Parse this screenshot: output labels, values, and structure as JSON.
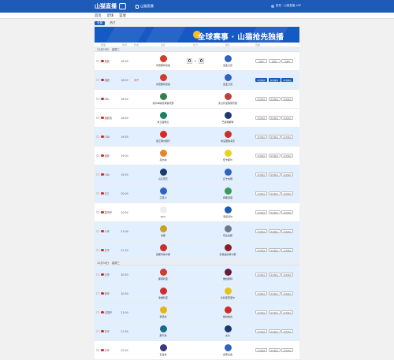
{
  "header": {
    "logo_text": "山猫直播",
    "app_label": "山猫直播",
    "login_text": "登录 · 山猫直播 APP"
  },
  "nav": [
    "首页",
    "足球",
    "篮球"
  ],
  "tabs": [
    "全部",
    "热门"
  ],
  "banner": {
    "title": "全球赛事 · 山猫抢先独播"
  },
  "columns": [
    "赛事",
    "时间",
    "状态",
    "主队",
    "比分",
    "客队",
    "直播"
  ],
  "days": [
    {
      "date": "12月29日",
      "weekday": "星期二",
      "matches": [
        {
          "league": "英超",
          "time": "18:00",
          "status": "",
          "home": "布雷斯特竞技",
          "away": "圣亚力克",
          "score": [
            "0",
            "0"
          ],
          "live": false,
          "home_color": "#d13b2c",
          "away_color": "#2f63c2",
          "links": [
            "直播1",
            "直播2",
            "直播3"
          ],
          "links_on": [
            false,
            false,
            false
          ]
        },
        {
          "league": "英超",
          "time": "18:00",
          "status": "未开",
          "home": "布雷斯特竞技",
          "away": "圣亚力克",
          "score": null,
          "live": true,
          "home_color": "#d13b2c",
          "away_color": "#2f63c2",
          "links": [
            "中文解说",
            "英文解说",
            "中文解说"
          ],
          "links_on": [
            true,
            true,
            true
          ]
        },
        {
          "league": "NBL",
          "time": "18:00",
          "status": "",
          "home": "墨尔本联足球俱乐部",
          "away": "泰山珍宝狗俱乐部",
          "score": null,
          "live": false,
          "home_color": "#3a7a4b",
          "away_color": "#c43d3d",
          "links": [
            "中文解说",
            "中文解说",
            "中文解说"
          ],
          "links_on": [
            false,
            false,
            false
          ]
        },
        {
          "league": "澳超赛",
          "time": "18:00",
          "status": "",
          "home": "米兰霍佩兰",
          "away": "巴塞勒斯特",
          "score": null,
          "live": false,
          "home_color": "#1a8066",
          "away_color": "#1c3a6f",
          "links": [
            "中文解说",
            "中文解说",
            "中文解说"
          ],
          "links_on": [
            false,
            false,
            false
          ]
        },
        {
          "league": "CBA",
          "time": "19:35",
          "status": "",
          "home": "浙江稠州银行",
          "away": "青岛国信海天",
          "score": null,
          "live": true,
          "home_color": "#d9281f",
          "away_color": "#c9302c",
          "links": [
            "中文解说",
            "中文解说",
            "中文解说"
          ],
          "links_on": [
            false,
            false,
            false
          ]
        },
        {
          "league": "澳超",
          "time": "19:00",
          "status": "",
          "home": "墨尔本",
          "away": "纽卡斯尔",
          "score": null,
          "live": false,
          "home_color": "#e6862a",
          "away_color": "#e8d21a",
          "links": [
            "中文解说",
            "中文解说",
            "中文解说"
          ],
          "links_on": [
            false,
            false,
            false
          ]
        },
        {
          "league": "CBA",
          "time": "19:35",
          "status": "",
          "home": "山东西王",
          "away": "辽宁本钢",
          "score": null,
          "live": true,
          "home_color": "#1c3a6f",
          "away_color": "#2f63c2",
          "links": [
            "中文解说",
            "中文解说",
            "中文解说"
          ],
          "links_on": [
            false,
            false,
            false
          ]
        },
        {
          "league": "法乙",
          "time": "20:00",
          "status": "",
          "home": "艾克沙",
          "away": "伊斯顿恩",
          "score": null,
          "live": true,
          "home_color": "#2f63c2",
          "away_color": "#3a9a5c",
          "links": [
            "中文解说",
            "中文解说",
            "中文解说"
          ],
          "links_on": [
            false,
            false,
            false
          ]
        },
        {
          "league": "塞甲杯",
          "time": "20:00",
          "status": "",
          "home": "Sem",
          "away": "海伍德尔",
          "score": null,
          "live": false,
          "home_color": "#eeeeee",
          "away_color": "#1e5bb8",
          "links": [
            "中文解说",
            "中文解说",
            "中文解说"
          ],
          "links_on": [
            false,
            false,
            false
          ]
        },
        {
          "league": "沙甲",
          "time": "21:00",
          "status": "",
          "home": "塞斯",
          "away": "巴比喜斯",
          "score": null,
          "live": true,
          "home_color": "#c9a21a",
          "away_color": "#6a7a8a",
          "links": [
            "中文解说",
            "中文解说",
            "中文解说"
          ],
          "links_on": [
            false,
            false,
            false
          ]
        },
        {
          "league": "意甲",
          "time": "21:30",
          "status": "",
          "home": "费斯科佛卡斯",
          "away": "科莫迪塞特卡斯",
          "score": null,
          "live": true,
          "home_color": "#c9302c",
          "away_color": "#8a1c2c",
          "links": [
            "中文解说",
            "中文解说",
            "中文解说"
          ],
          "links_on": [
            false,
            false,
            false
          ]
        }
      ]
    },
    {
      "date": "12月30日",
      "weekday": "星期三",
      "matches": [
        {
          "league": "法甲",
          "time": "20:30",
          "status": "",
          "home": "斯塔利亚",
          "away": "维拉斯特",
          "score": null,
          "live": true,
          "home_color": "#d13b2c",
          "away_color": "#6a1c3c",
          "links": [
            "中文解说",
            "中文解说",
            "中文解说"
          ],
          "links_on": [
            false,
            false,
            false
          ]
        },
        {
          "league": "德甲",
          "time": "20:30",
          "status": "",
          "home": "塞维利亚",
          "away": "比利亚雷亚尔",
          "score": null,
          "live": true,
          "home_color": "#c9302c",
          "away_color": "#e8c21a",
          "links": [
            "中文解说",
            "中文解说",
            "中文解说"
          ],
          "links_on": [
            false,
            false,
            false
          ]
        },
        {
          "league": "法国杯",
          "time": "21:00",
          "status": "",
          "home": "费洛拉",
          "away": "格拉纳达",
          "score": null,
          "live": true,
          "home_color": "#e8b21a",
          "away_color": "#c9302c",
          "links": [
            "中文解说",
            "中文解说",
            "中文解说"
          ],
          "links_on": [
            false,
            false,
            false
          ]
        },
        {
          "league": "意甲",
          "time": "21:30",
          "status": "",
          "home": "那不勒",
          "away": "尤文",
          "score": null,
          "live": true,
          "home_color": "#1c6a8a",
          "away_color": "#1a3a6f",
          "links": [
            "中文解说",
            "中文解说",
            "中文解说"
          ],
          "links_on": [
            false,
            false,
            false
          ]
        },
        {
          "league": "法甲",
          "time": "22:00",
          "status": "",
          "home": "瓦拉多",
          "away": "皇家社会",
          "score": null,
          "live": false,
          "home_color": "#3a3a7a",
          "away_color": "#2f63c2",
          "links": [
            "中文解说",
            "中文解说",
            "中文解说"
          ],
          "links_on": [
            false,
            false,
            false
          ]
        }
      ]
    }
  ]
}
